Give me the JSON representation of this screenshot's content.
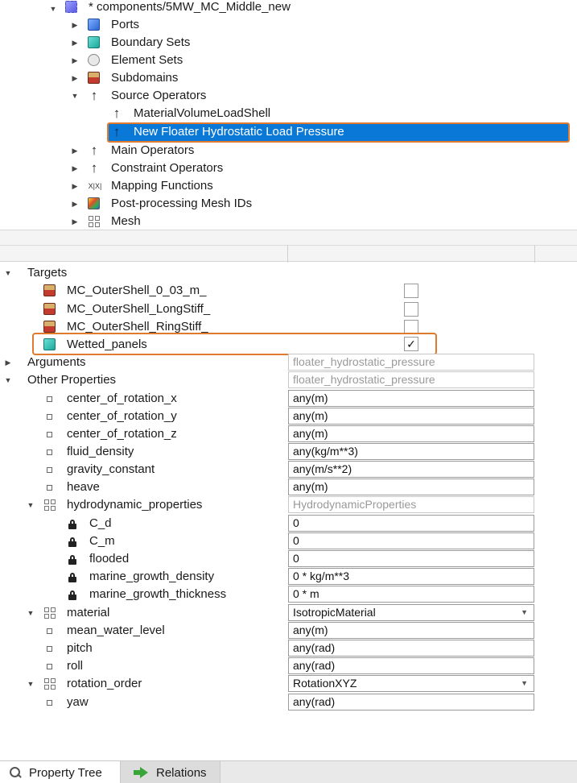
{
  "tree": {
    "root_label": "* components/5MW_MC_Middle_new",
    "items": [
      {
        "label": "Ports"
      },
      {
        "label": "Boundary Sets"
      },
      {
        "label": "Element Sets"
      },
      {
        "label": "Subdomains"
      },
      {
        "label": "Source Operators"
      },
      {
        "label": "MaterialVolumeLoadShell"
      },
      {
        "label": "New Floater Hydrostatic Load Pressure"
      },
      {
        "label": "Main Operators"
      },
      {
        "label": "Constraint Operators"
      },
      {
        "label": "Mapping Functions"
      },
      {
        "label": "Post-processing Mesh IDs"
      },
      {
        "label": "Mesh"
      }
    ],
    "mapping_icon_text": "X|X|"
  },
  "props": {
    "targets_label": "Targets",
    "targets": [
      {
        "label": "MC_OuterShell_0_03_m_",
        "checked": ""
      },
      {
        "label": "MC_OuterShell_LongStiff_",
        "checked": ""
      },
      {
        "label": "MC_OuterShell_RingStiff_",
        "checked": ""
      },
      {
        "label": "Wetted_panels",
        "checked": "✓"
      }
    ],
    "arguments_label": "Arguments",
    "arguments_value": "floater_hydrostatic_pressure",
    "other_label": "Other Properties",
    "other_value": "floater_hydrostatic_pressure",
    "rows": [
      {
        "label": "center_of_rotation_x",
        "value": "any(m)"
      },
      {
        "label": "center_of_rotation_y",
        "value": "any(m)"
      },
      {
        "label": "center_of_rotation_z",
        "value": "any(m)"
      },
      {
        "label": "fluid_density",
        "value": "any(kg/m**3)"
      },
      {
        "label": "gravity_constant",
        "value": "any(m/s**2)"
      },
      {
        "label": "heave",
        "value": "any(m)"
      },
      {
        "label": "hydrodynamic_properties",
        "value": "HydrodynamicProperties"
      },
      {
        "label": "C_d",
        "value": "0"
      },
      {
        "label": "C_m",
        "value": "0"
      },
      {
        "label": "flooded",
        "value": "0"
      },
      {
        "label": "marine_growth_density",
        "value": "0 * kg/m**3"
      },
      {
        "label": "marine_growth_thickness",
        "value": "0 * m"
      },
      {
        "label": "material",
        "value": "IsotropicMaterial"
      },
      {
        "label": "mean_water_level",
        "value": "any(m)"
      },
      {
        "label": "pitch",
        "value": "any(rad)"
      },
      {
        "label": "roll",
        "value": "any(rad)"
      },
      {
        "label": "rotation_order",
        "value": "RotationXYZ"
      },
      {
        "label": "yaw",
        "value": "any(rad)"
      }
    ]
  },
  "tabs": {
    "property_tree": "Property Tree",
    "relations": "Relations"
  },
  "colors": {
    "selection": "#0a78d7",
    "highlight": "#e07a2e"
  }
}
